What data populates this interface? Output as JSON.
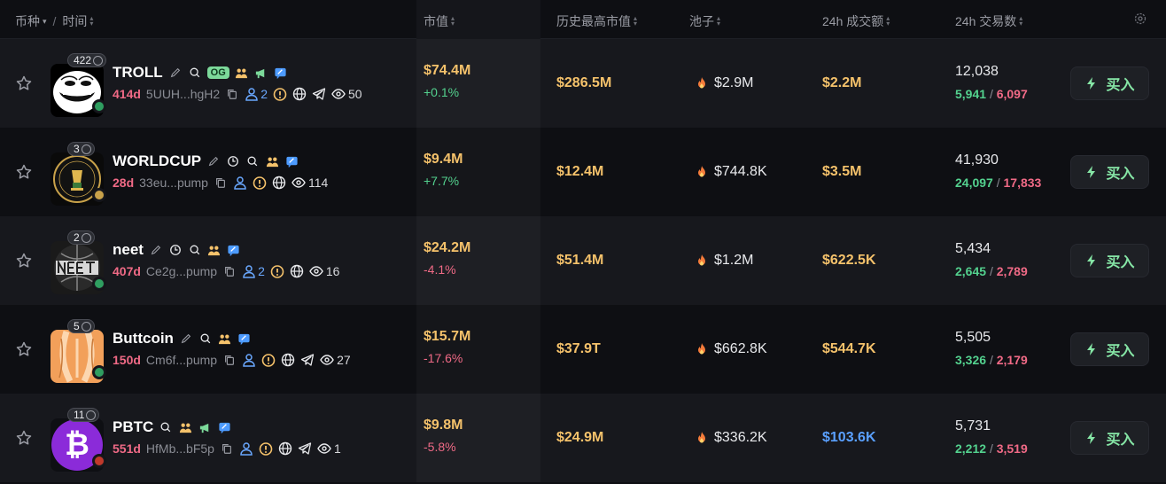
{
  "header": {
    "coin_label": "币种",
    "time_label": "时间",
    "mcap_label": "市值",
    "ath_label": "历史最高市值",
    "pool_label": "池子",
    "volume_label": "24h 成交额",
    "txns_label": "24h 交易数"
  },
  "colors": {
    "accent_gold": "#f5c26b",
    "up": "#53d18e",
    "down": "#f06a86",
    "link_blue": "#5aa0ff",
    "buy_green": "#86e6a6"
  },
  "rows": [
    {
      "holders_badge": "422",
      "name": "TROLL",
      "og": "OG",
      "age": "414d",
      "address": "5UUH...hgH2",
      "holders": "2",
      "views": "50",
      "mcap": "$74.4M",
      "change": "+0.1%",
      "ath": "$286.5M",
      "pool": "$2.9M",
      "volume": "$2.2M",
      "txns": "12,038",
      "buys": "5,941",
      "sells": "6,097",
      "buy_label": "买入"
    },
    {
      "holders_badge": "3",
      "name": "WORLDCUP",
      "age": "28d",
      "address": "33eu...pump",
      "views": "114",
      "mcap": "$9.4M",
      "change": "+7.7%",
      "ath": "$12.4M",
      "pool": "$744.8K",
      "volume": "$3.5M",
      "txns": "41,930",
      "buys": "24,097",
      "sells": "17,833",
      "buy_label": "买入"
    },
    {
      "holders_badge": "2",
      "name": "neet",
      "age": "407d",
      "address": "Ce2g...pump",
      "holders": "2",
      "views": "16",
      "mcap": "$24.2M",
      "change": "-4.1%",
      "ath": "$51.4M",
      "pool": "$1.2M",
      "volume": "$622.5K",
      "txns": "5,434",
      "buys": "2,645",
      "sells": "2,789",
      "buy_label": "买入"
    },
    {
      "holders_badge": "5",
      "name": "Buttcoin",
      "age": "150d",
      "address": "Cm6f...pump",
      "views": "27",
      "mcap": "$15.7M",
      "change": "-17.6%",
      "ath": "$37.9T",
      "pool": "$662.8K",
      "volume": "$544.7K",
      "txns": "5,505",
      "buys": "3,326",
      "sells": "2,179",
      "buy_label": "买入"
    },
    {
      "holders_badge": "11",
      "name": "PBTC",
      "age": "551d",
      "address": "HfMb...bF5p",
      "views": "1",
      "mcap": "$9.8M",
      "change": "-5.8%",
      "ath": "$24.9M",
      "pool": "$336.2K",
      "volume": "$103.6K",
      "txns": "5,731",
      "buys": "2,212",
      "sells": "3,519",
      "buy_label": "买入"
    }
  ]
}
